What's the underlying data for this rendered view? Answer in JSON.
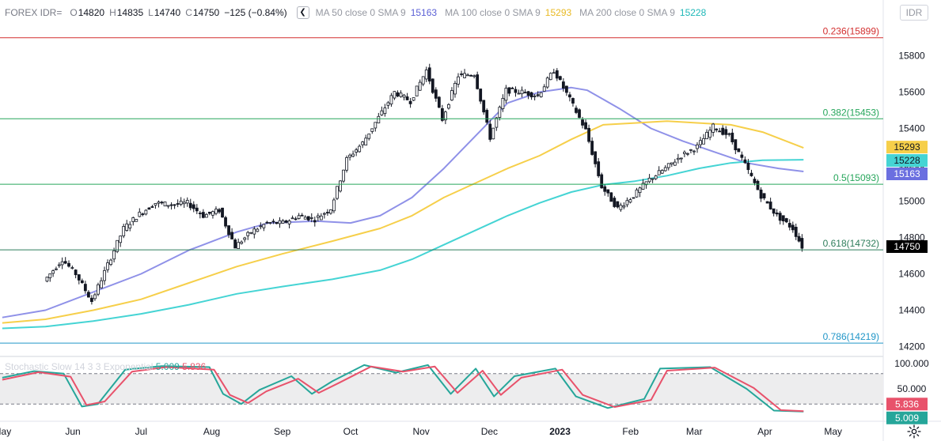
{
  "legend": {
    "symbol": "FOREX IDR=",
    "o_label": "O",
    "open": "14820",
    "h_label": "H",
    "high": "14835",
    "l_label": "L",
    "low": "14740",
    "c_label": "C",
    "close": "14750",
    "change": "−125 (−0.84%)",
    "collapse_icon": "chevron-left-icon",
    "ma50_label": "MA 50 close 0 SMA 9",
    "ma50_value": "15163",
    "ma100_label": "MA 100 close 0 SMA 9",
    "ma100_value": "15293",
    "ma200_label": "MA 200 close 0 SMA 9",
    "ma200_value": "15228"
  },
  "currency_button": "IDR",
  "stochastic": {
    "label": "Stochastic Slow 14 3 3 Exponential",
    "k_value": "5.009",
    "d_value": "5.836",
    "axis_ticks": [
      "100.000",
      "50.000"
    ],
    "upper_band": 80,
    "lower_band": 20
  },
  "settings_icon": "gear-icon",
  "colors": {
    "up": "#131722",
    "down": "#131722",
    "ma50": "#8f91e8",
    "ma100": "#f6cf4a",
    "ma200": "#45d4d4",
    "fib_top": "#d32f2f",
    "fib_green": "#26a65b",
    "fib_low": "#2196c8",
    "stoch_k": "#26a69a",
    "stoch_d": "#e8526b",
    "price_label": "#000000"
  },
  "chart_data": {
    "type": "line",
    "title": "FOREX IDR=",
    "y_ticks": [
      "15800",
      "15600",
      "15400",
      "15200",
      "15000",
      "14800",
      "14600",
      "14400",
      "14200"
    ],
    "x_ticks": [
      "May",
      "Jun",
      "Jul",
      "Aug",
      "Sep",
      "Oct",
      "Nov",
      "Dec",
      "2023",
      "Feb",
      "Mar",
      "Apr",
      "May"
    ],
    "ylim": [
      14150,
      15950
    ],
    "fib_levels": [
      {
        "label": "0.236(15899)",
        "value": 15899
      },
      {
        "label": "0.382(15453)",
        "value": 15453
      },
      {
        "label": "0.5(15093)",
        "value": 15093
      },
      {
        "label": "0.618(14732)",
        "value": 14732
      },
      {
        "label": "0.786(14219)",
        "value": 14219
      }
    ],
    "price_labels": {
      "ma100": "15293",
      "ma200": "15228",
      "ma50": "15163",
      "last": "14750"
    },
    "price_path": [
      {
        "x": "2022-05-20",
        "y": 14560
      },
      {
        "x": "2022-05-28",
        "y": 14680
      },
      {
        "x": "2022-06-03",
        "y": 14600
      },
      {
        "x": "2022-06-10",
        "y": 14450
      },
      {
        "x": "2022-06-17",
        "y": 14650
      },
      {
        "x": "2022-06-24",
        "y": 14850
      },
      {
        "x": "2022-07-01",
        "y": 14930
      },
      {
        "x": "2022-07-08",
        "y": 14990
      },
      {
        "x": "2022-07-15",
        "y": 14980
      },
      {
        "x": "2022-07-22",
        "y": 14990
      },
      {
        "x": "2022-07-29",
        "y": 14920
      },
      {
        "x": "2022-08-05",
        "y": 14950
      },
      {
        "x": "2022-08-12",
        "y": 14750
      },
      {
        "x": "2022-08-19",
        "y": 14830
      },
      {
        "x": "2022-08-26",
        "y": 14880
      },
      {
        "x": "2022-09-02",
        "y": 14880
      },
      {
        "x": "2022-09-09",
        "y": 14920
      },
      {
        "x": "2022-09-16",
        "y": 14900
      },
      {
        "x": "2022-09-23",
        "y": 14960
      },
      {
        "x": "2022-09-30",
        "y": 15230
      },
      {
        "x": "2022-10-07",
        "y": 15320
      },
      {
        "x": "2022-10-14",
        "y": 15460
      },
      {
        "x": "2022-10-21",
        "y": 15600
      },
      {
        "x": "2022-10-28",
        "y": 15550
      },
      {
        "x": "2022-11-04",
        "y": 15720
      },
      {
        "x": "2022-11-11",
        "y": 15450
      },
      {
        "x": "2022-11-18",
        "y": 15690
      },
      {
        "x": "2022-11-25",
        "y": 15700
      },
      {
        "x": "2022-12-02",
        "y": 15350
      },
      {
        "x": "2022-12-09",
        "y": 15610
      },
      {
        "x": "2022-12-16",
        "y": 15600
      },
      {
        "x": "2022-12-23",
        "y": 15580
      },
      {
        "x": "2022-12-30",
        "y": 15720
      },
      {
        "x": "2023-01-06",
        "y": 15560
      },
      {
        "x": "2023-01-13",
        "y": 15390
      },
      {
        "x": "2023-01-20",
        "y": 15080
      },
      {
        "x": "2023-01-27",
        "y": 14960
      },
      {
        "x": "2023-02-03",
        "y": 15030
      },
      {
        "x": "2023-02-10",
        "y": 15120
      },
      {
        "x": "2023-02-17",
        "y": 15180
      },
      {
        "x": "2023-02-24",
        "y": 15250
      },
      {
        "x": "2023-03-03",
        "y": 15300
      },
      {
        "x": "2023-03-10",
        "y": 15410
      },
      {
        "x": "2023-03-17",
        "y": 15360
      },
      {
        "x": "2023-03-24",
        "y": 15200
      },
      {
        "x": "2023-03-31",
        "y": 15030
      },
      {
        "x": "2023-04-07",
        "y": 14920
      },
      {
        "x": "2023-04-14",
        "y": 14850
      },
      {
        "x": "2023-04-18",
        "y": 14750
      }
    ],
    "series": [
      {
        "name": "MA 50 close 0 SMA 9",
        "points": [
          {
            "x": "2022-05-01",
            "y": 14360
          },
          {
            "x": "2022-05-20",
            "y": 14400
          },
          {
            "x": "2022-06-10",
            "y": 14500
          },
          {
            "x": "2022-07-01",
            "y": 14600
          },
          {
            "x": "2022-07-22",
            "y": 14730
          },
          {
            "x": "2022-08-12",
            "y": 14830
          },
          {
            "x": "2022-08-26",
            "y": 14880
          },
          {
            "x": "2022-09-16",
            "y": 14890
          },
          {
            "x": "2022-10-01",
            "y": 14880
          },
          {
            "x": "2022-10-14",
            "y": 14920
          },
          {
            "x": "2022-10-28",
            "y": 15020
          },
          {
            "x": "2022-11-11",
            "y": 15180
          },
          {
            "x": "2022-11-25",
            "y": 15360
          },
          {
            "x": "2022-12-09",
            "y": 15540
          },
          {
            "x": "2022-12-23",
            "y": 15600
          },
          {
            "x": "2023-01-06",
            "y": 15625
          },
          {
            "x": "2023-01-13",
            "y": 15610
          },
          {
            "x": "2023-01-27",
            "y": 15510
          },
          {
            "x": "2023-02-10",
            "y": 15400
          },
          {
            "x": "2023-02-24",
            "y": 15330
          },
          {
            "x": "2023-03-10",
            "y": 15270
          },
          {
            "x": "2023-03-24",
            "y": 15210
          },
          {
            "x": "2023-04-07",
            "y": 15180
          },
          {
            "x": "2023-04-18",
            "y": 15163
          }
        ]
      },
      {
        "name": "MA 100 close 0 SMA 9",
        "points": [
          {
            "x": "2022-05-01",
            "y": 14330
          },
          {
            "x": "2022-05-20",
            "y": 14350
          },
          {
            "x": "2022-06-10",
            "y": 14400
          },
          {
            "x": "2022-07-01",
            "y": 14460
          },
          {
            "x": "2022-07-22",
            "y": 14550
          },
          {
            "x": "2022-08-12",
            "y": 14640
          },
          {
            "x": "2022-09-01",
            "y": 14710
          },
          {
            "x": "2022-09-23",
            "y": 14780
          },
          {
            "x": "2022-10-14",
            "y": 14850
          },
          {
            "x": "2022-10-28",
            "y": 14920
          },
          {
            "x": "2022-11-11",
            "y": 15020
          },
          {
            "x": "2022-11-25",
            "y": 15100
          },
          {
            "x": "2022-12-09",
            "y": 15180
          },
          {
            "x": "2022-12-23",
            "y": 15250
          },
          {
            "x": "2023-01-06",
            "y": 15340
          },
          {
            "x": "2023-01-20",
            "y": 15420
          },
          {
            "x": "2023-02-03",
            "y": 15430
          },
          {
            "x": "2023-02-17",
            "y": 15440
          },
          {
            "x": "2023-03-03",
            "y": 15430
          },
          {
            "x": "2023-03-17",
            "y": 15420
          },
          {
            "x": "2023-03-31",
            "y": 15380
          },
          {
            "x": "2023-04-18",
            "y": 15293
          }
        ]
      },
      {
        "name": "MA 200 close 0 SMA 9",
        "points": [
          {
            "x": "2022-05-01",
            "y": 14300
          },
          {
            "x": "2022-05-20",
            "y": 14310
          },
          {
            "x": "2022-06-10",
            "y": 14340
          },
          {
            "x": "2022-07-01",
            "y": 14380
          },
          {
            "x": "2022-07-22",
            "y": 14430
          },
          {
            "x": "2022-08-12",
            "y": 14490
          },
          {
            "x": "2022-09-01",
            "y": 14530
          },
          {
            "x": "2022-09-23",
            "y": 14570
          },
          {
            "x": "2022-10-14",
            "y": 14620
          },
          {
            "x": "2022-10-28",
            "y": 14680
          },
          {
            "x": "2022-11-11",
            "y": 14760
          },
          {
            "x": "2022-11-25",
            "y": 14840
          },
          {
            "x": "2022-12-09",
            "y": 14920
          },
          {
            "x": "2022-12-23",
            "y": 14990
          },
          {
            "x": "2023-01-06",
            "y": 15050
          },
          {
            "x": "2023-01-20",
            "y": 15090
          },
          {
            "x": "2023-02-03",
            "y": 15110
          },
          {
            "x": "2023-02-17",
            "y": 15140
          },
          {
            "x": "2023-03-03",
            "y": 15180
          },
          {
            "x": "2023-03-17",
            "y": 15210
          },
          {
            "x": "2023-03-31",
            "y": 15225
          },
          {
            "x": "2023-04-18",
            "y": 15228
          }
        ]
      }
    ],
    "stoch_k": [
      {
        "x": "2022-05-01",
        "y": 72
      },
      {
        "x": "2022-05-15",
        "y": 85
      },
      {
        "x": "2022-05-28",
        "y": 80
      },
      {
        "x": "2022-06-05",
        "y": 15
      },
      {
        "x": "2022-06-12",
        "y": 20
      },
      {
        "x": "2022-06-24",
        "y": 88
      },
      {
        "x": "2022-07-10",
        "y": 95
      },
      {
        "x": "2022-07-31",
        "y": 93
      },
      {
        "x": "2022-08-06",
        "y": 40
      },
      {
        "x": "2022-08-14",
        "y": 20
      },
      {
        "x": "2022-08-22",
        "y": 48
      },
      {
        "x": "2022-09-05",
        "y": 75
      },
      {
        "x": "2022-09-14",
        "y": 40
      },
      {
        "x": "2022-09-23",
        "y": 65
      },
      {
        "x": "2022-10-07",
        "y": 97
      },
      {
        "x": "2022-10-21",
        "y": 82
      },
      {
        "x": "2022-11-04",
        "y": 97
      },
      {
        "x": "2022-11-14",
        "y": 40
      },
      {
        "x": "2022-11-25",
        "y": 90
      },
      {
        "x": "2022-12-03",
        "y": 35
      },
      {
        "x": "2022-12-12",
        "y": 75
      },
      {
        "x": "2022-12-30",
        "y": 90
      },
      {
        "x": "2023-01-08",
        "y": 35
      },
      {
        "x": "2023-01-22",
        "y": 12
      },
      {
        "x": "2023-02-07",
        "y": 30
      },
      {
        "x": "2023-02-14",
        "y": 90
      },
      {
        "x": "2023-03-08",
        "y": 93
      },
      {
        "x": "2023-03-24",
        "y": 50
      },
      {
        "x": "2023-04-05",
        "y": 7
      },
      {
        "x": "2023-04-18",
        "y": 5
      }
    ],
    "stoch_d": [
      {
        "x": "2022-05-01",
        "y": 68
      },
      {
        "x": "2022-05-17",
        "y": 83
      },
      {
        "x": "2022-05-31",
        "y": 74
      },
      {
        "x": "2022-06-07",
        "y": 18
      },
      {
        "x": "2022-06-15",
        "y": 25
      },
      {
        "x": "2022-06-27",
        "y": 84
      },
      {
        "x": "2022-07-12",
        "y": 93
      },
      {
        "x": "2022-08-02",
        "y": 88
      },
      {
        "x": "2022-08-09",
        "y": 38
      },
      {
        "x": "2022-08-17",
        "y": 22
      },
      {
        "x": "2022-08-25",
        "y": 45
      },
      {
        "x": "2022-09-08",
        "y": 70
      },
      {
        "x": "2022-09-17",
        "y": 42
      },
      {
        "x": "2022-09-26",
        "y": 62
      },
      {
        "x": "2022-10-10",
        "y": 94
      },
      {
        "x": "2022-10-24",
        "y": 84
      },
      {
        "x": "2022-11-07",
        "y": 94
      },
      {
        "x": "2022-11-17",
        "y": 42
      },
      {
        "x": "2022-11-28",
        "y": 86
      },
      {
        "x": "2022-12-06",
        "y": 38
      },
      {
        "x": "2022-12-15",
        "y": 72
      },
      {
        "x": "2023-01-02",
        "y": 88
      },
      {
        "x": "2023-01-11",
        "y": 38
      },
      {
        "x": "2023-01-25",
        "y": 14
      },
      {
        "x": "2023-02-10",
        "y": 28
      },
      {
        "x": "2023-02-17",
        "y": 86
      },
      {
        "x": "2023-03-10",
        "y": 92
      },
      {
        "x": "2023-03-27",
        "y": 52
      },
      {
        "x": "2023-04-08",
        "y": 8
      },
      {
        "x": "2023-04-18",
        "y": 5.836
      }
    ]
  }
}
